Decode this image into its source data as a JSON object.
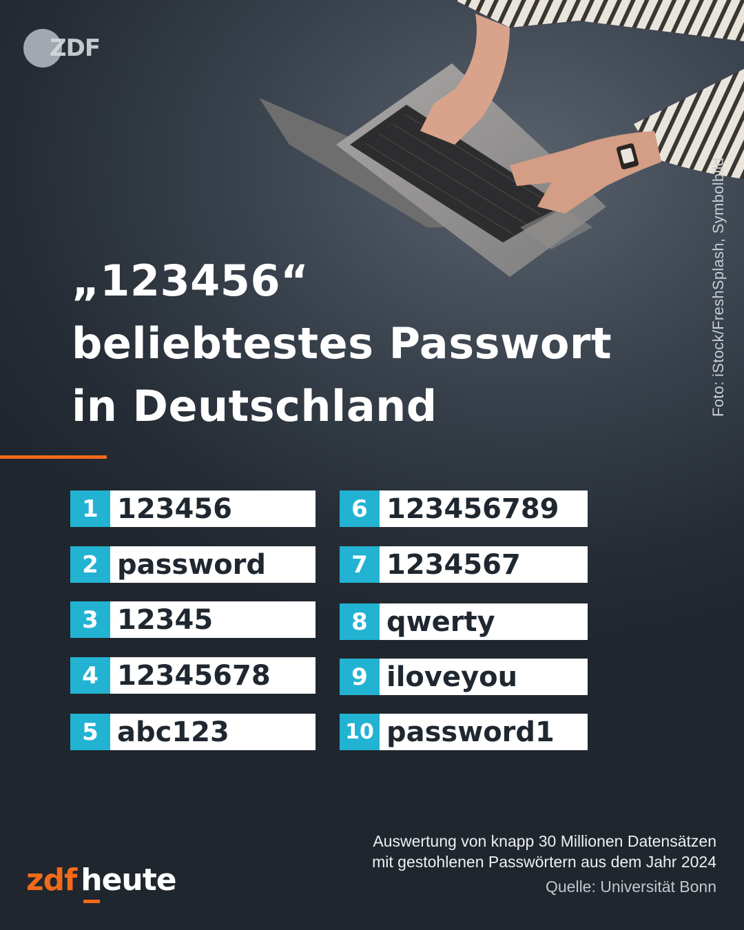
{
  "logo": {
    "text": "ZDF"
  },
  "photo_credit": "Foto: iStock/FreshSplash, Symbolbild",
  "headline": {
    "line1": "„123456“",
    "line2": "beliebtestes Passwort",
    "line3": "in Deutschland"
  },
  "ranking": [
    {
      "rank": "1",
      "password": "123456"
    },
    {
      "rank": "2",
      "password": "password"
    },
    {
      "rank": "3",
      "password": "12345"
    },
    {
      "rank": "4",
      "password": "12345678"
    },
    {
      "rank": "5",
      "password": "abc123"
    },
    {
      "rank": "6",
      "password": "123456789"
    },
    {
      "rank": "7",
      "password": "1234567"
    },
    {
      "rank": "8",
      "password": "qwerty"
    },
    {
      "rank": "9",
      "password": "iloveyou"
    },
    {
      "rank": "10",
      "password": "password1"
    }
  ],
  "footer": {
    "description_line1": "Auswertung von knapp 30 Millionen Datensätzen",
    "description_line2": "mit gestohlenen Passwörtern aus dem Jahr 2024",
    "source": "Quelle: Universität Bonn",
    "brand_zdf": "zdf",
    "brand_heute": "heute"
  },
  "colors": {
    "accent_orange": "#f26a1b",
    "rank_blue": "#22b3d2",
    "background": "#2a323c"
  }
}
